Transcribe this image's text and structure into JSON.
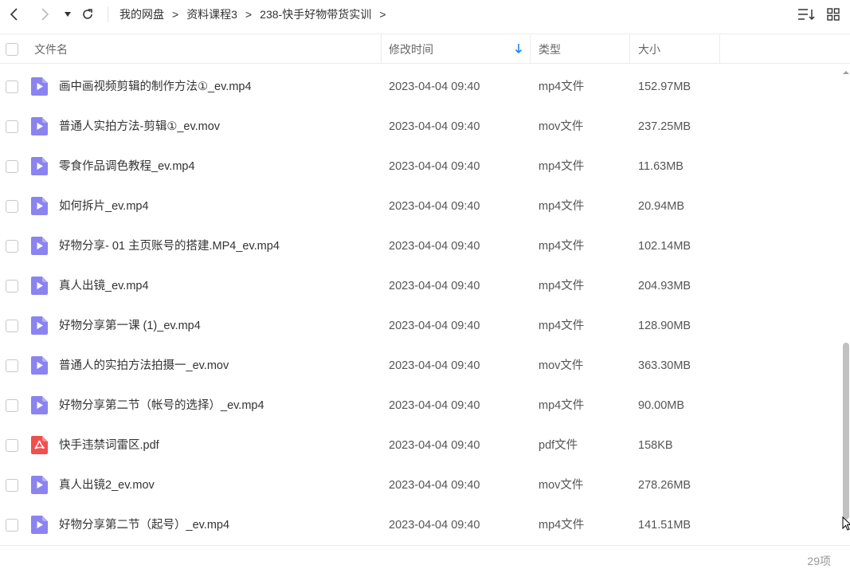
{
  "breadcrumb": [
    "我的网盘",
    "资料课程3",
    "238-快手好物带货实训"
  ],
  "breadcrumb_separator": ">",
  "columns": {
    "name": "文件名",
    "modified": "修改时间",
    "type": "类型",
    "size": "大小"
  },
  "sort": {
    "column": "modified",
    "direction": "down"
  },
  "colors": {
    "video_icon": "#8b83f0",
    "pdf_icon": "#f04f4f",
    "sort_arrow": "#1e88e5"
  },
  "files": [
    {
      "name": "画中画视频剪辑的制作方法①_ev.mp4",
      "modified": "2023-04-04 09:40",
      "type": "mp4文件",
      "size": "152.97MB",
      "icon": "video-file-icon"
    },
    {
      "name": "普通人实拍方法-剪辑①_ev.mov",
      "modified": "2023-04-04 09:40",
      "type": "mov文件",
      "size": "237.25MB",
      "icon": "video-file-icon"
    },
    {
      "name": "零食作品调色教程_ev.mp4",
      "modified": "2023-04-04 09:40",
      "type": "mp4文件",
      "size": "11.63MB",
      "icon": "video-file-icon"
    },
    {
      "name": "如何拆片_ev.mp4",
      "modified": "2023-04-04 09:40",
      "type": "mp4文件",
      "size": "20.94MB",
      "icon": "video-file-icon"
    },
    {
      "name": "好物分享- 01 主页账号的搭建.MP4_ev.mp4",
      "modified": "2023-04-04 09:40",
      "type": "mp4文件",
      "size": "102.14MB",
      "icon": "video-file-icon"
    },
    {
      "name": "真人出镜_ev.mp4",
      "modified": "2023-04-04 09:40",
      "type": "mp4文件",
      "size": "204.93MB",
      "icon": "video-file-icon"
    },
    {
      "name": "好物分享第一课 (1)_ev.mp4",
      "modified": "2023-04-04 09:40",
      "type": "mp4文件",
      "size": "128.90MB",
      "icon": "video-file-icon"
    },
    {
      "name": "普通人的实拍方法拍摄一_ev.mov",
      "modified": "2023-04-04 09:40",
      "type": "mov文件",
      "size": "363.30MB",
      "icon": "video-file-icon"
    },
    {
      "name": "好物分享第二节（帐号的选择）_ev.mp4",
      "modified": "2023-04-04 09:40",
      "type": "mp4文件",
      "size": "90.00MB",
      "icon": "video-file-icon"
    },
    {
      "name": "快手违禁词雷区.pdf",
      "modified": "2023-04-04 09:40",
      "type": "pdf文件",
      "size": "158KB",
      "icon": "pdf-file-icon"
    },
    {
      "name": "真人出镜2_ev.mov",
      "modified": "2023-04-04 09:40",
      "type": "mov文件",
      "size": "278.26MB",
      "icon": "video-file-icon"
    },
    {
      "name": "好物分享第二节（起号）_ev.mp4",
      "modified": "2023-04-04 09:40",
      "type": "mp4文件",
      "size": "141.51MB",
      "icon": "video-file-icon"
    }
  ],
  "footer": {
    "count": "29项"
  }
}
